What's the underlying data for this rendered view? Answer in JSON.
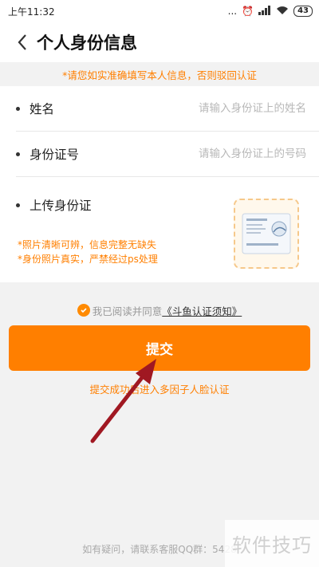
{
  "status_bar": {
    "time": "上午11:32",
    "signal": "...",
    "battery": "43"
  },
  "header": {
    "title": "个人身份信息"
  },
  "notice": "*请您如实准确填写本人信息，否则驳回认证",
  "form": {
    "name_label": "姓名",
    "name_placeholder": "请输入身份证上的姓名",
    "id_label": "身份证号",
    "id_placeholder": "请输入身份证上的号码",
    "upload_label": "上传身份证",
    "tip1": "*照片清晰可辨，信息完整无缺失",
    "tip2": "*身份照片真实，严禁经过ps处理"
  },
  "agreement": {
    "prefix": "我已阅读并同意",
    "link": "《斗鱼认证须知》",
    "checked": true
  },
  "submit_label": "提交",
  "next_step": "提交成功后进入多因子人脸认证",
  "footer": "如有疑问，请联系客服QQ群：5428",
  "watermark": "软件技巧",
  "colors": {
    "accent": "#ff7f00",
    "arrow": "#a01822"
  }
}
